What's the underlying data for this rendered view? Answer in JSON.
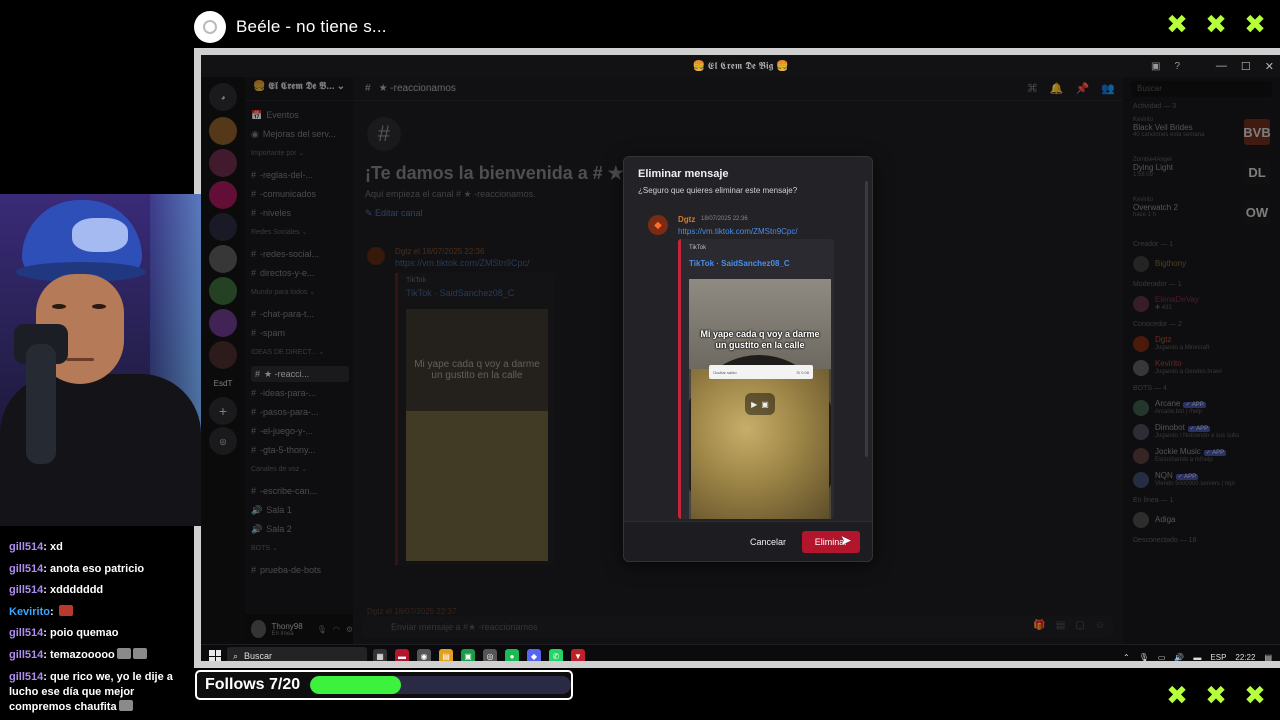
{
  "now_playing": {
    "title": "Beéle - no tiene s..."
  },
  "window": {
    "title": "🍔 𝕰𝖑 𝕮𝖗𝖊𝖒 𝕯𝖊 𝕭𝖎𝖌 🍔",
    "controls": [
      "—",
      "☐",
      "✕"
    ]
  },
  "server": {
    "name": "🍔 𝕰𝖑 𝕮𝖗𝖊𝖒 𝕯𝖊 𝕭...",
    "guild_labels": [
      "EsdT"
    ]
  },
  "channels": {
    "rows": [
      {
        "type": "item",
        "icon": "📅",
        "label": "Eventos"
      },
      {
        "type": "item",
        "icon": "◉",
        "label": "Mejoras del serv..."
      },
      {
        "type": "cat",
        "label": "Importante por ⌄"
      },
      {
        "type": "item",
        "icon": "#",
        "label": "-reglas-del-..."
      },
      {
        "type": "item",
        "icon": "#",
        "label": "-comunicados"
      },
      {
        "type": "item",
        "icon": "#",
        "label": "-niveles"
      },
      {
        "type": "cat",
        "label": "Redes Sociales ⌄"
      },
      {
        "type": "item",
        "icon": "#",
        "label": "-redes-social..."
      },
      {
        "type": "item",
        "icon": "#",
        "label": "directos-y-e..."
      },
      {
        "type": "cat",
        "label": "Mundo para todos ⌄"
      },
      {
        "type": "item",
        "icon": "#",
        "label": "-chat-para-t..."
      },
      {
        "type": "item",
        "icon": "#",
        "label": "-spam"
      },
      {
        "type": "cat",
        "label": "IDEAS DE DIRECT... ⌄"
      },
      {
        "type": "active",
        "icon": "#",
        "label": "★ -reacci..."
      },
      {
        "type": "item",
        "icon": "#",
        "label": "-ideas-para-..."
      },
      {
        "type": "item",
        "icon": "#",
        "label": "-pasos-para-..."
      },
      {
        "type": "item",
        "icon": "#",
        "label": "-el-juego-y-..."
      },
      {
        "type": "item",
        "icon": "#",
        "label": "-gta-5-thony..."
      },
      {
        "type": "cat",
        "label": "Canales de voz ⌄"
      },
      {
        "type": "item",
        "icon": "#",
        "label": "-escribe-can..."
      },
      {
        "type": "item",
        "icon": "🔊",
        "label": "Sala 1"
      },
      {
        "type": "item",
        "icon": "🔊",
        "label": "Sala 2"
      },
      {
        "type": "cat",
        "label": "BOTS ⌄"
      },
      {
        "type": "item",
        "icon": "#",
        "label": "prueba-de-bots"
      }
    ],
    "user": {
      "name": "Thony98",
      "status": "En línea"
    }
  },
  "main": {
    "header": "★ -reaccionamos",
    "welcome": "¡Te damos la bienvenida a # ★ -r",
    "welcome_sub": "Aquí empieza el canal # ★ -reaccionamos.",
    "edit_channel": "✎ Editar canal",
    "bg_author": "Dgtz   el 18/07/2025 22:36",
    "bg_link": "https://vm.tiktok.com/ZMStn9Cpc/",
    "bg_provider": "TikTok",
    "bg_title": "TikTok · SaidSanchez08_C",
    "bg_caption": "Mi yape cada q voy a darme un gustito en la calle",
    "bg_second_author": "Dgtz   el 18/07/2025 22:37",
    "input_placeholder": "Enviar mensaje a #★ -reaccionamos"
  },
  "members": {
    "search_placeholder": "Buscar",
    "activity_title": "Actividad — 3",
    "activity": [
      {
        "user": "Kevirito",
        "game": "Black Veil Brides",
        "sub": "40 canciones esta semana",
        "icon": "BVB",
        "color": "#6a2a1a"
      },
      {
        "user": "Zombie4Angel",
        "game": "Dying Light",
        "sub": "1:58:09",
        "icon": "DL",
        "color": "#1a1a1a"
      },
      {
        "user": "Kevirito",
        "game": "Overwatch 2",
        "sub": "hace 1 h",
        "icon": "OW",
        "color": "#1a1a1a"
      }
    ],
    "groups": [
      {
        "title": "Creador — 1",
        "items": [
          {
            "name": "Bigthony",
            "sub": "",
            "color": "#7a6a2a",
            "av": "#3a3a3a"
          }
        ]
      },
      {
        "title": "Moderador — 1",
        "items": [
          {
            "name": "ElenaDeVay",
            "sub": "✚ 433",
            "color": "#7a2a4a",
            "av": "#5a3040"
          }
        ]
      },
      {
        "title": "Conocedor — 2",
        "items": [
          {
            "name": "Dgtz",
            "sub": "Jugando a Minecraft",
            "color": "#b44a2a",
            "av": "#7a2b12"
          },
          {
            "name": "Kevirito",
            "sub": "Jugando a Geodes brawl",
            "color": "#a6402a",
            "av": "#5a5a5a"
          }
        ]
      },
      {
        "title": "BOTS — 4",
        "items": [
          {
            "name": "Arcane",
            "sub": "Arcane.bot | /help",
            "color": "#8a8a8a",
            "av": "#3a5a4a",
            "badge": "✓ APP"
          },
          {
            "name": "Dimobot",
            "sub": "Jugando / Nutriendo a sus subs",
            "color": "#8a8a8a",
            "av": "#4a4a5a",
            "badge": "✓ APP"
          },
          {
            "name": "Jockie Music",
            "sub": "Escuchando a m!help",
            "color": "#8a8a8a",
            "av": "#5a3a3a",
            "badge": "✓ APP"
          },
          {
            "name": "NQN",
            "sub": "Viendo 5000000 servers | nqn",
            "color": "#8a8a8a",
            "av": "#3a4a6a",
            "badge": "✓ APP"
          }
        ]
      },
      {
        "title": "En línea — 1",
        "items": [
          {
            "name": "Adiga",
            "sub": "",
            "color": "#8a8a8a",
            "av": "#4a4a4a"
          }
        ]
      },
      {
        "title": "Desconectado — 18",
        "items": []
      }
    ]
  },
  "modal": {
    "title": "Eliminar mensaje",
    "subtitle": "¿Seguro que quieres eliminar este mensaje?",
    "author": "Dgtz",
    "date": "18/07/2025 22:36",
    "link": "https://vm.tiktok.com/ZMStn9Cpc/",
    "embed_provider": "TikTok",
    "embed_title": "TikTok · SaidSanchez08_C",
    "caption": "Mi yape cada q voy a darme un gustito en la calle",
    "sheet_left": "Ocultar saldo",
    "sheet_right": "S/ 0.08",
    "cancel": "Cancelar",
    "delete": "Eliminar"
  },
  "taskbar": {
    "search": "Buscar",
    "lang": "ESP",
    "time": "22:22",
    "apps": [
      {
        "label": "▦",
        "color": "#333"
      },
      {
        "label": "▬",
        "color": "#b3162c"
      },
      {
        "label": "◉",
        "color": "#555"
      },
      {
        "label": "▤",
        "color": "#e0a020"
      },
      {
        "label": "▣",
        "color": "#1a9a4a"
      },
      {
        "label": "◎",
        "color": "#555"
      },
      {
        "label": "●",
        "color": "#1db954"
      },
      {
        "label": "◆",
        "color": "#5865f2"
      },
      {
        "label": "✆",
        "color": "#25d366"
      },
      {
        "label": "▼",
        "color": "#c0202a"
      }
    ]
  },
  "chat": [
    {
      "user": "gill514",
      "text": "xd",
      "emotes": []
    },
    {
      "user": "gill514",
      "text": "anota eso patricio",
      "emotes": []
    },
    {
      "user": "gill514",
      "text": "xddddddd",
      "emotes": []
    },
    {
      "user": "Kevirito",
      "text": "",
      "emotes": [
        "red"
      ]
    },
    {
      "user": "gill514",
      "text": "poio quemao",
      "emotes": []
    },
    {
      "user": "gill514",
      "text": "temazooooo",
      "emotes": [
        "grey",
        "grey"
      ]
    },
    {
      "user": "gill514",
      "text": "que rico we, yo le dije a lucho ese día que mejor compremos chaufita",
      "emotes": [
        "grey"
      ]
    }
  ],
  "follows": {
    "label": "Follows 7/20",
    "current": 7,
    "goal": 20
  },
  "colors": {
    "accent": "#b3162c",
    "link": "#4b8ee8",
    "progress": "#3df23d",
    "x_marks": "#b6ff3b"
  }
}
